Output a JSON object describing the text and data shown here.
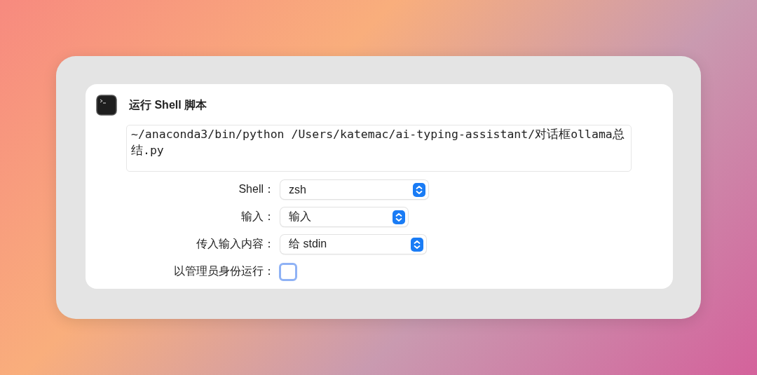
{
  "action": {
    "title": "运行 Shell 脚本",
    "script": "~/anaconda3/bin/python /Users/katemac/ai-typing-assistant/对话框ollama总结.py",
    "fields": [
      {
        "kind": "popup",
        "label": "Shell：",
        "value": "zsh"
      },
      {
        "kind": "popup",
        "label": "输入：",
        "value": "输入"
      },
      {
        "kind": "popup",
        "label": "传入输入内容：",
        "value": "给 stdin"
      },
      {
        "kind": "checkbox",
        "label": "以管理员身份运行：",
        "checked": false
      }
    ]
  }
}
